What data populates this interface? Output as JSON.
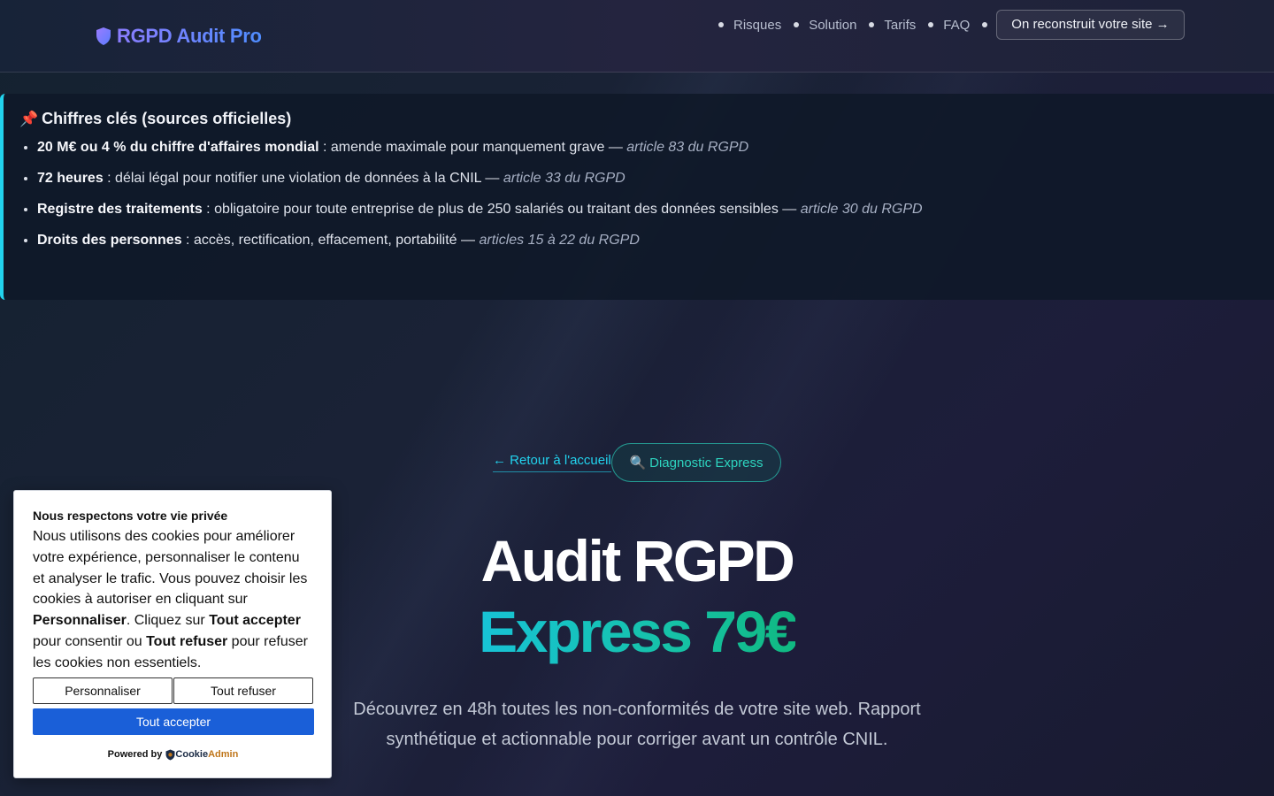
{
  "header": {
    "brand": "RGPD Audit Pro",
    "nav": [
      {
        "label": "Risques"
      },
      {
        "label": "Solution"
      },
      {
        "label": "Tarifs"
      },
      {
        "label": "FAQ"
      }
    ],
    "cta_label": "On reconstruit votre site →"
  },
  "key_figures": {
    "heading": "Chiffres clés (sources officielles)",
    "items": [
      {
        "bold": "20 M€ ou 4 % du chiffre d'affaires mondial",
        "text": " : amende maximale pour manquement grave — ",
        "source": "article 83 du RGPD"
      },
      {
        "bold": "72 heures",
        "text": " : délai légal pour notifier une violation de données à la CNIL — ",
        "source": "article 33 du RGPD"
      },
      {
        "bold": "Registre des traitements",
        "text": " : obligatoire pour toute entreprise de plus de 250 salariés ou traitant des données sensibles — ",
        "source": "article 30 du RGPD"
      },
      {
        "bold": "Droits des personnes",
        "text": " : accès, rectification, effacement, portabilité — ",
        "source": "articles 15 à 22 du RGPD"
      }
    ]
  },
  "hero": {
    "back_link": "← Retour à l'accueil",
    "badge": "Diagnostic Express",
    "title_line1": "Audit RGPD",
    "title_line2": "Express 79€",
    "subtitle": "Découvrez en 48h toutes les non-conformités de votre site web. Rapport synthétique et actionnable pour corriger avant un contrôle CNIL."
  },
  "cookie_banner": {
    "title": "Nous respectons votre vie privée",
    "text_1": "Nous utilisons des cookies pour améliorer votre expérience, personnaliser le contenu et analyser le trafic. Vous pouvez choisir les cookies à autoriser en cliquant sur ",
    "bold_1": "Personnaliser",
    "text_2": ". Cliquez sur ",
    "bold_2": "Tout accepter",
    "text_3": " pour consentir ou ",
    "bold_3": "Tout refuser",
    "text_4": " pour refuser les cookies non essentiels.",
    "customize_label": "Personnaliser",
    "reject_label": "Tout refuser",
    "accept_label": "Tout accepter",
    "powered_by": "Powered by",
    "brand_part1": "Cookie",
    "brand_part2": "Admin"
  },
  "colors": {
    "accent_cyan": "#22d3ee",
    "accent_teal": "#10b981",
    "cookie_primary": "#1a5fd8"
  }
}
